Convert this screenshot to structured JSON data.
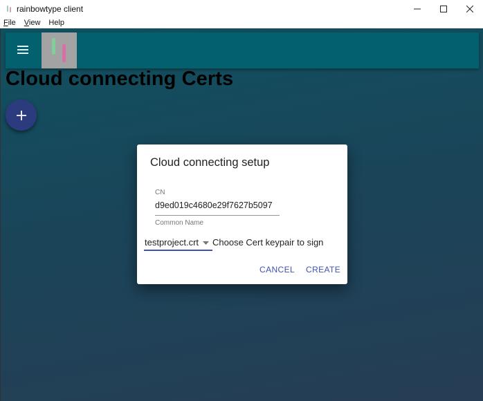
{
  "window": {
    "title": "rainbowtype client",
    "menu": [
      {
        "label": "File",
        "mnemonic": "F",
        "rest": "ile"
      },
      {
        "label": "View",
        "mnemonic": "V",
        "rest": "iew"
      },
      {
        "label": "Help",
        "mnemonic": "",
        "rest": "Help"
      }
    ],
    "controls": [
      "minimize-icon",
      "maximize-icon",
      "close-icon"
    ]
  },
  "appbar": {
    "menu_icon": "hamburger-menu-icon",
    "logo_icon": "rainbowtype-logo",
    "logo_colors": [
      "#7fcf9a",
      "#d96fa8"
    ],
    "background": "#02616c"
  },
  "page": {
    "title": "Cloud connecting Certs",
    "fab_icon": "plus-icon"
  },
  "dialog": {
    "title": "Cloud connecting setup",
    "cn_label": "CN",
    "cn_value": "d9ed019c4680e29f7627b5097",
    "cn_helper": "Common Name",
    "keypair_select": "testproject.crt",
    "keypair_hint": "Choose Cert keypair to sign",
    "cancel_label": "CANCEL",
    "create_label": "CREATE",
    "accent": "#3f51b5"
  }
}
